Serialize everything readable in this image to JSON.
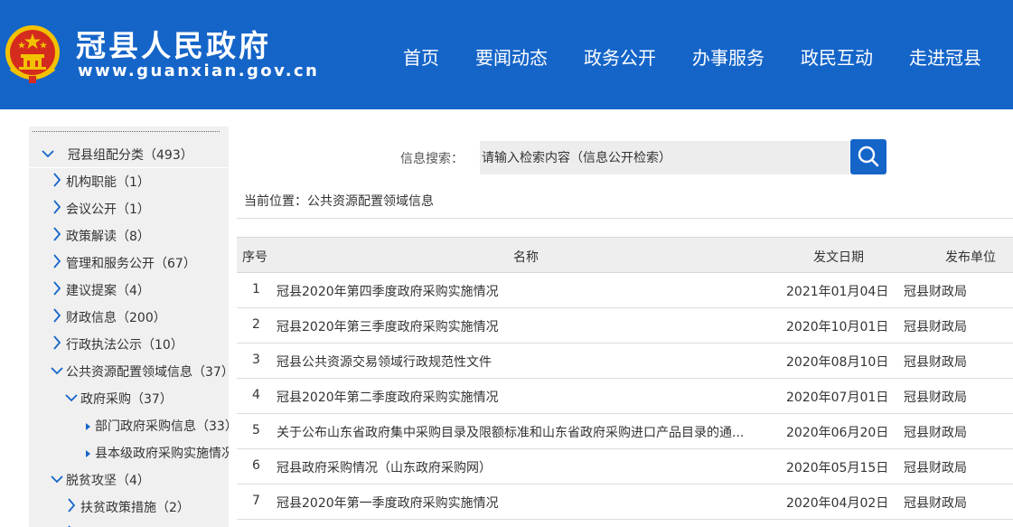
{
  "header": {
    "site_title": "冠县人民政府",
    "site_url": "www.guanxian.gov.cn",
    "nav": [
      "首页",
      "要闻动态",
      "政务公开",
      "办事服务",
      "政民互动",
      "走进冠县"
    ]
  },
  "colors": {
    "brand_blue": "#1565c9",
    "sidebar_bg": "#f0f0f0",
    "table_header_bg": "#eeeeee"
  },
  "sidebar": {
    "items": [
      {
        "label": "冠县组配分类（493）",
        "icon": "chevron-down-icon"
      },
      {
        "label": "机构职能（1）",
        "icon": "chevron-right-icon"
      },
      {
        "label": "会议公开（1）",
        "icon": "chevron-right-icon"
      },
      {
        "label": "政策解读（8）",
        "icon": "chevron-right-icon"
      },
      {
        "label": "管理和服务公开（67）",
        "icon": "chevron-right-icon"
      },
      {
        "label": "建议提案（4）",
        "icon": "chevron-right-icon"
      },
      {
        "label": "财政信息（200）",
        "icon": "chevron-right-icon"
      },
      {
        "label": "行政执法公示（10）",
        "icon": "chevron-right-icon"
      },
      {
        "label": "公共资源配置领域信息（37）",
        "icon": "chevron-down-icon"
      },
      {
        "label": "政府采购（37）",
        "icon": "chevron-down-icon"
      },
      {
        "label": "部门政府采购信息（33）",
        "icon": "bullet-icon"
      },
      {
        "label": "县本级政府采购实施情况",
        "icon": "bullet-icon"
      },
      {
        "label": "脱贫攻坚（4）",
        "icon": "chevron-down-icon"
      },
      {
        "label": "扶贫政策措施（2）",
        "icon": "chevron-right-icon"
      }
    ]
  },
  "search": {
    "label": "信息搜索：",
    "placeholder": "请输入检索内容（信息公开检索）",
    "button_icon": "search-icon"
  },
  "breadcrumb": "当前位置：公共资源配置领域信息",
  "table": {
    "headers": {
      "num": "序号",
      "title": "名称",
      "date": "发文日期",
      "unit": "发布单位"
    },
    "rows": [
      {
        "num": "1",
        "title": "冠县2020年第四季度政府采购实施情况",
        "date": "2021年01月04日",
        "unit": "冠县财政局"
      },
      {
        "num": "2",
        "title": "冠县2020年第三季度政府采购实施情况",
        "date": "2020年10月01日",
        "unit": "冠县财政局"
      },
      {
        "num": "3",
        "title": "冠县公共资源交易领域行政规范性文件",
        "date": "2020年08月10日",
        "unit": "冠县财政局"
      },
      {
        "num": "4",
        "title": "冠县2020年第二季度政府采购实施情况",
        "date": "2020年07月01日",
        "unit": "冠县财政局"
      },
      {
        "num": "5",
        "title": "关于公布山东省政府集中采购目录及限额标准和山东省政府采购进口产品目录的通...",
        "date": "2020年06月20日",
        "unit": "冠县财政局"
      },
      {
        "num": "6",
        "title": "冠县政府采购情况（山东政府采购网）",
        "date": "2020年05月15日",
        "unit": "冠县财政局"
      },
      {
        "num": "7",
        "title": "冠县2020年第一季度政府采购实施情况",
        "date": "2020年04月02日",
        "unit": "冠县财政局"
      }
    ]
  }
}
